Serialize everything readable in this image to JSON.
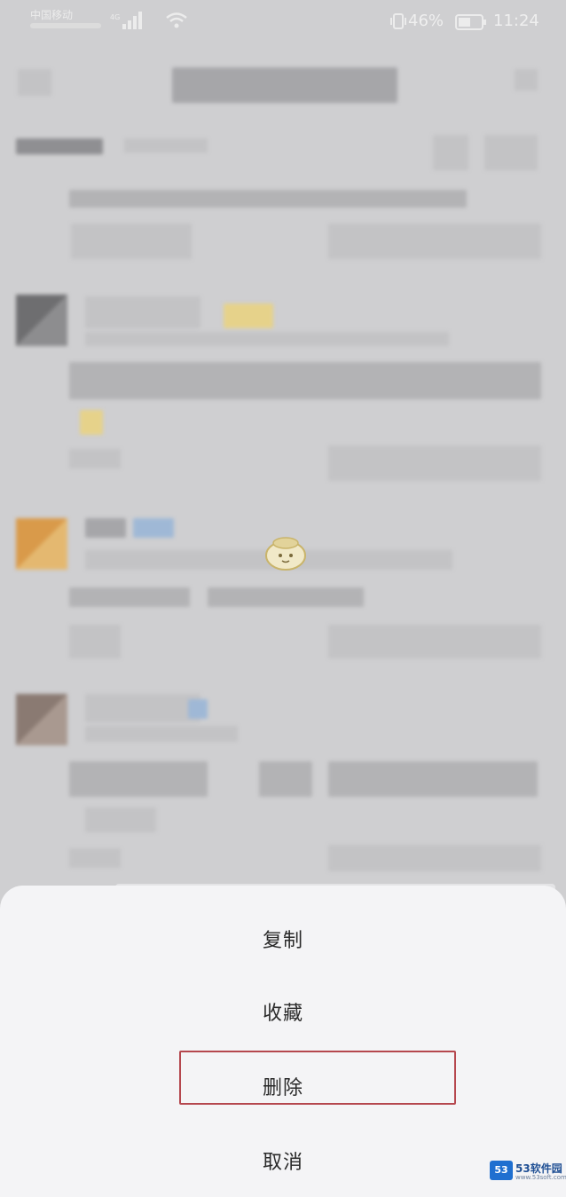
{
  "status_bar": {
    "carrier": "中国移动",
    "battery": "46%",
    "time": "11:24",
    "icons": [
      "signal-icon",
      "wifi-icon",
      "vibrate-icon",
      "battery-icon"
    ]
  },
  "action_sheet": {
    "items": [
      {
        "label": "复制"
      },
      {
        "label": "收藏"
      },
      {
        "label": "删除",
        "highlighted": true
      },
      {
        "label": "取消"
      }
    ],
    "highlight_color": "#b5474e"
  },
  "watermark": {
    "logo": "53",
    "title": "53软件园",
    "url": "www.53soft.com"
  },
  "colors": {
    "overlay": "#cfcfd1",
    "sheet_background": "#f4f4f6",
    "text": "#2a2a2a"
  }
}
